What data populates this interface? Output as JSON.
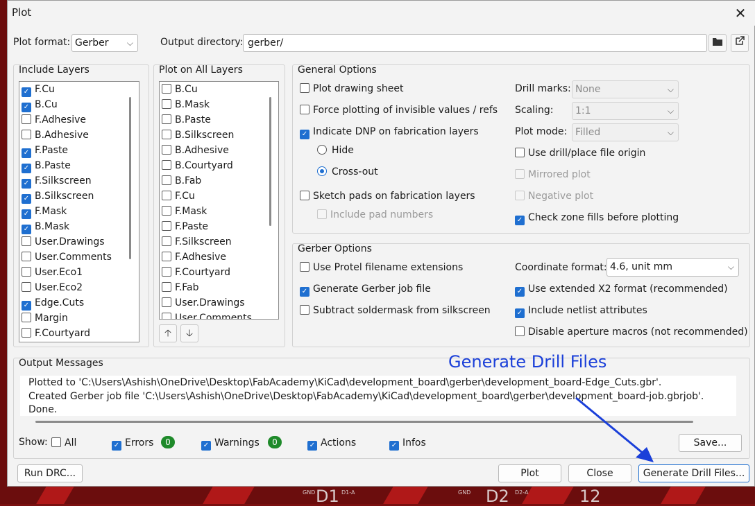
{
  "window": {
    "title": "Plot",
    "close_icon": "close-icon"
  },
  "plot_format": {
    "label": "Plot format:",
    "value": "Gerber"
  },
  "output_directory": {
    "label": "Output directory:",
    "value": "gerber/"
  },
  "include_layers": {
    "title": "Include Layers",
    "items": [
      {
        "label": "F.Cu",
        "checked": true
      },
      {
        "label": "B.Cu",
        "checked": true
      },
      {
        "label": "F.Adhesive",
        "checked": false
      },
      {
        "label": "B.Adhesive",
        "checked": false
      },
      {
        "label": "F.Paste",
        "checked": true
      },
      {
        "label": "B.Paste",
        "checked": true
      },
      {
        "label": "F.Silkscreen",
        "checked": true
      },
      {
        "label": "B.Silkscreen",
        "checked": true
      },
      {
        "label": "F.Mask",
        "checked": true
      },
      {
        "label": "B.Mask",
        "checked": true
      },
      {
        "label": "User.Drawings",
        "checked": false
      },
      {
        "label": "User.Comments",
        "checked": false
      },
      {
        "label": "User.Eco1",
        "checked": false
      },
      {
        "label": "User.Eco2",
        "checked": false
      },
      {
        "label": "Edge.Cuts",
        "checked": true
      },
      {
        "label": "Margin",
        "checked": false
      },
      {
        "label": "F.Courtyard",
        "checked": false
      }
    ]
  },
  "plot_all_layers": {
    "title": "Plot on All Layers",
    "items": [
      {
        "label": "B.Cu",
        "checked": false
      },
      {
        "label": "B.Mask",
        "checked": false
      },
      {
        "label": "B.Paste",
        "checked": false
      },
      {
        "label": "B.Silkscreen",
        "checked": false
      },
      {
        "label": "B.Adhesive",
        "checked": false
      },
      {
        "label": "B.Courtyard",
        "checked": false
      },
      {
        "label": "B.Fab",
        "checked": false
      },
      {
        "label": "F.Cu",
        "checked": false
      },
      {
        "label": "F.Mask",
        "checked": false
      },
      {
        "label": "F.Paste",
        "checked": false
      },
      {
        "label": "F.Silkscreen",
        "checked": false
      },
      {
        "label": "F.Adhesive",
        "checked": false
      },
      {
        "label": "F.Courtyard",
        "checked": false
      },
      {
        "label": "F.Fab",
        "checked": false
      },
      {
        "label": "User.Drawings",
        "checked": false
      },
      {
        "label": "User.Comments",
        "checked": false
      }
    ]
  },
  "general": {
    "title": "General Options",
    "plot_drawing_sheet": "Plot drawing sheet",
    "force_plotting": "Force plotting of invisible values / refs",
    "indicate_dnp": "Indicate DNP on fabrication layers",
    "hide": "Hide",
    "cross_out": "Cross-out",
    "sketch_pads": "Sketch pads on fabrication layers",
    "include_pad_numbers": "Include pad numbers",
    "drill_marks_label": "Drill marks:",
    "drill_marks_value": "None",
    "scaling_label": "Scaling:",
    "scaling_value": "1:1",
    "plot_mode_label": "Plot mode:",
    "plot_mode_value": "Filled",
    "use_drill_origin": "Use drill/place file origin",
    "mirrored_plot": "Mirrored plot",
    "negative_plot": "Negative plot",
    "check_zone_fills": "Check zone fills before plotting"
  },
  "gerber": {
    "title": "Gerber Options",
    "protel": "Use Protel filename extensions",
    "job_file": "Generate Gerber job file",
    "subtract_mask": "Subtract soldermask from silkscreen",
    "coord_label": "Coordinate format:",
    "coord_value": "4.6, unit mm",
    "x2": "Use extended X2 format (recommended)",
    "netlist": "Include netlist attributes",
    "aperture": "Disable aperture macros (not recommended)"
  },
  "messages": {
    "title": "Output Messages",
    "lines": [
      "Plotted to 'C:\\Users\\Ashish\\OneDrive\\Desktop\\FabAcademy\\KiCad\\development_board\\gerber\\development_board-Edge_Cuts.gbr'.",
      "Created Gerber job file 'C:\\Users\\Ashish\\OneDrive\\Desktop\\FabAcademy\\KiCad\\development_board\\gerber\\development_board-job.gbrjob'.",
      "Done."
    ]
  },
  "filters": {
    "show": "Show:",
    "all": "All",
    "errors": "Errors",
    "errors_count": "0",
    "warnings": "Warnings",
    "warnings_count": "0",
    "actions": "Actions",
    "infos": "Infos",
    "save": "Save..."
  },
  "buttons": {
    "run_drc": "Run DRC...",
    "plot": "Plot",
    "close": "Close",
    "generate_drill": "Generate Drill Files..."
  },
  "annotation": {
    "text": "Generate Drill Files",
    "color": "#1a3fd9"
  },
  "background": {
    "labels": [
      "D1",
      "D2",
      "12",
      "GND",
      "GND",
      "D1-A",
      "D2-A"
    ]
  }
}
